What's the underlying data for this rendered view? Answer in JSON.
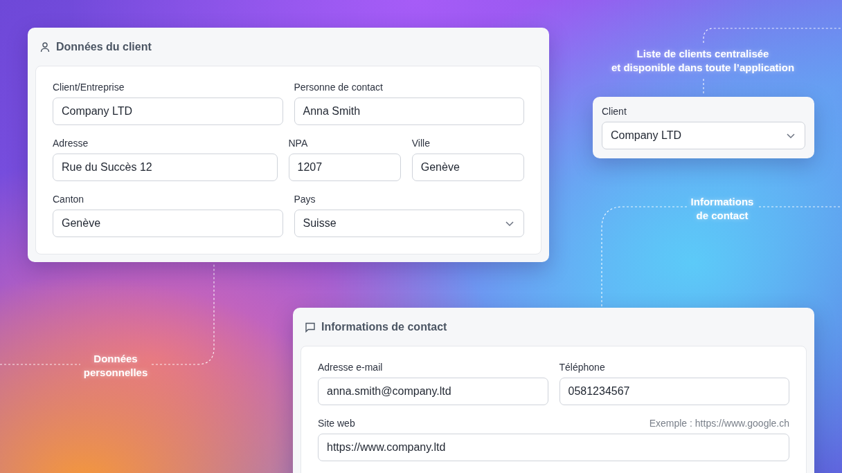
{
  "client_card": {
    "title": "Données du client",
    "rows": [
      [
        {
          "label": "Client/Entreprise",
          "value": "Company LTD",
          "kind": "text"
        },
        {
          "label": "Personne de contact",
          "value": "Anna Smith",
          "kind": "text"
        }
      ],
      [
        {
          "label": "Adresse",
          "value": "Rue du Succès 12",
          "kind": "text"
        },
        {
          "label": "NPA",
          "value": "1207",
          "kind": "text"
        },
        {
          "label": "Ville",
          "value": "Genève",
          "kind": "text"
        }
      ],
      [
        {
          "label": "Canton",
          "value": "Genève",
          "kind": "text"
        },
        {
          "label": "Pays",
          "value": "Suisse",
          "kind": "select"
        }
      ]
    ]
  },
  "client_picker": {
    "label": "Client",
    "value": "Company LTD",
    "kind": "select"
  },
  "contact_card": {
    "title": "Informations de contact",
    "rows": [
      [
        {
          "label": "Adresse e-mail",
          "value": "anna.smith@company.ltd",
          "kind": "text"
        },
        {
          "label": "Téléphone",
          "value": "0581234567",
          "kind": "text"
        }
      ],
      [
        {
          "label": "Site web",
          "hint": "Exemple : https://www.google.ch",
          "value": "https://www.company.ltd",
          "kind": "text"
        }
      ]
    ]
  },
  "annotations": [
    {
      "lines": [
        "Liste de clients centralisée",
        "et disponible dans toute l’application"
      ]
    },
    {
      "lines": [
        "Informations",
        "de contact"
      ]
    },
    {
      "lines": [
        "Données",
        "personnelles"
      ]
    }
  ]
}
